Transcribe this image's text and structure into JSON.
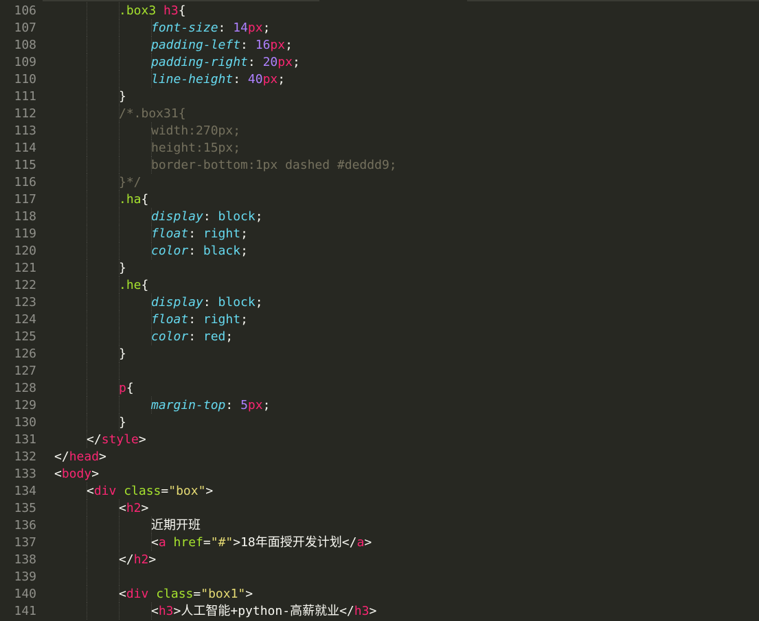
{
  "editor": {
    "theme": "monokai",
    "colors": {
      "background": "#272822",
      "line_number": "#90908a",
      "punctuation": "#f8f8f2",
      "selector": "#a6e22e",
      "tag": "#f92672",
      "property": "#66d9ef",
      "number": "#ae81ff",
      "unit": "#f92672",
      "value": "#66d9ef",
      "comment": "#75715e",
      "attribute": "#a6e22e",
      "string": "#e6db74",
      "text": "#f8f8f2"
    },
    "lines": [
      {
        "num": "106",
        "indent": 2,
        "tokens": [
          {
            "t": "sel",
            "v": ".box3 "
          },
          {
            "t": "tag",
            "v": "h3"
          },
          {
            "t": "punct",
            "v": "{"
          }
        ]
      },
      {
        "num": "107",
        "indent": 3,
        "tokens": [
          {
            "t": "prop",
            "v": "font-size"
          },
          {
            "t": "punct",
            "v": ": "
          },
          {
            "t": "num",
            "v": "14"
          },
          {
            "t": "unit",
            "v": "px"
          },
          {
            "t": "punct",
            "v": ";"
          }
        ]
      },
      {
        "num": "108",
        "indent": 3,
        "tokens": [
          {
            "t": "prop",
            "v": "padding-left"
          },
          {
            "t": "punct",
            "v": ": "
          },
          {
            "t": "num",
            "v": "16"
          },
          {
            "t": "unit",
            "v": "px"
          },
          {
            "t": "punct",
            "v": ";"
          }
        ]
      },
      {
        "num": "109",
        "indent": 3,
        "tokens": [
          {
            "t": "prop",
            "v": "padding-right"
          },
          {
            "t": "punct",
            "v": ": "
          },
          {
            "t": "num",
            "v": "20"
          },
          {
            "t": "unit",
            "v": "px"
          },
          {
            "t": "punct",
            "v": ";"
          }
        ]
      },
      {
        "num": "110",
        "indent": 3,
        "tokens": [
          {
            "t": "prop",
            "v": "line-height"
          },
          {
            "t": "punct",
            "v": ": "
          },
          {
            "t": "num",
            "v": "40"
          },
          {
            "t": "unit",
            "v": "px"
          },
          {
            "t": "punct",
            "v": ";"
          }
        ]
      },
      {
        "num": "111",
        "indent": 2,
        "tokens": [
          {
            "t": "punct",
            "v": "}"
          }
        ]
      },
      {
        "num": "112",
        "indent": 2,
        "tokens": [
          {
            "t": "comment",
            "v": "/*.box31{"
          }
        ]
      },
      {
        "num": "113",
        "indent": 3,
        "tokens": [
          {
            "t": "comment",
            "v": "width:270px;"
          }
        ]
      },
      {
        "num": "114",
        "indent": 3,
        "tokens": [
          {
            "t": "comment",
            "v": "height:15px;"
          }
        ]
      },
      {
        "num": "115",
        "indent": 3,
        "tokens": [
          {
            "t": "comment",
            "v": "border-bottom:1px dashed #deddd9;"
          }
        ]
      },
      {
        "num": "116",
        "indent": 2,
        "tokens": [
          {
            "t": "comment",
            "v": "}*/"
          }
        ]
      },
      {
        "num": "117",
        "indent": 2,
        "tokens": [
          {
            "t": "sel",
            "v": ".ha"
          },
          {
            "t": "punct",
            "v": "{"
          }
        ]
      },
      {
        "num": "118",
        "indent": 3,
        "tokens": [
          {
            "t": "prop",
            "v": "display"
          },
          {
            "t": "punct",
            "v": ": "
          },
          {
            "t": "val",
            "v": "block"
          },
          {
            "t": "punct",
            "v": ";"
          }
        ]
      },
      {
        "num": "119",
        "indent": 3,
        "tokens": [
          {
            "t": "prop",
            "v": "float"
          },
          {
            "t": "punct",
            "v": ": "
          },
          {
            "t": "val",
            "v": "right"
          },
          {
            "t": "punct",
            "v": ";"
          }
        ]
      },
      {
        "num": "120",
        "indent": 3,
        "tokens": [
          {
            "t": "prop",
            "v": "color"
          },
          {
            "t": "punct",
            "v": ": "
          },
          {
            "t": "val",
            "v": "black"
          },
          {
            "t": "punct",
            "v": ";"
          }
        ]
      },
      {
        "num": "121",
        "indent": 2,
        "tokens": [
          {
            "t": "punct",
            "v": "}"
          }
        ]
      },
      {
        "num": "122",
        "indent": 2,
        "tokens": [
          {
            "t": "sel",
            "v": ".he"
          },
          {
            "t": "punct",
            "v": "{"
          }
        ]
      },
      {
        "num": "123",
        "indent": 3,
        "tokens": [
          {
            "t": "prop",
            "v": "display"
          },
          {
            "t": "punct",
            "v": ": "
          },
          {
            "t": "val",
            "v": "block"
          },
          {
            "t": "punct",
            "v": ";"
          }
        ]
      },
      {
        "num": "124",
        "indent": 3,
        "tokens": [
          {
            "t": "prop",
            "v": "float"
          },
          {
            "t": "punct",
            "v": ": "
          },
          {
            "t": "val",
            "v": "right"
          },
          {
            "t": "punct",
            "v": ";"
          }
        ]
      },
      {
        "num": "125",
        "indent": 3,
        "tokens": [
          {
            "t": "prop",
            "v": "color"
          },
          {
            "t": "punct",
            "v": ": "
          },
          {
            "t": "val",
            "v": "red"
          },
          {
            "t": "punct",
            "v": ";"
          }
        ]
      },
      {
        "num": "126",
        "indent": 2,
        "tokens": [
          {
            "t": "punct",
            "v": "}"
          }
        ]
      },
      {
        "num": "127",
        "indent": 2,
        "tokens": []
      },
      {
        "num": "128",
        "indent": 2,
        "tokens": [
          {
            "t": "tag",
            "v": "p"
          },
          {
            "t": "punct",
            "v": "{"
          }
        ]
      },
      {
        "num": "129",
        "indent": 3,
        "tokens": [
          {
            "t": "prop",
            "v": "margin-top"
          },
          {
            "t": "punct",
            "v": ": "
          },
          {
            "t": "num",
            "v": "5"
          },
          {
            "t": "unit",
            "v": "px"
          },
          {
            "t": "punct",
            "v": ";"
          }
        ]
      },
      {
        "num": "130",
        "indent": 2,
        "tokens": [
          {
            "t": "punct",
            "v": "}"
          }
        ]
      },
      {
        "num": "131",
        "indent": 1,
        "tokens": [
          {
            "t": "punct",
            "v": "</"
          },
          {
            "t": "tag",
            "v": "style"
          },
          {
            "t": "punct",
            "v": ">"
          }
        ]
      },
      {
        "num": "132",
        "indent": 0,
        "tokens": [
          {
            "t": "punct",
            "v": "</"
          },
          {
            "t": "tag",
            "v": "head"
          },
          {
            "t": "punct",
            "v": ">"
          }
        ]
      },
      {
        "num": "133",
        "indent": 0,
        "tokens": [
          {
            "t": "punct",
            "v": "<"
          },
          {
            "t": "tag",
            "v": "body"
          },
          {
            "t": "punct",
            "v": ">"
          }
        ]
      },
      {
        "num": "134",
        "indent": 1,
        "tokens": [
          {
            "t": "punct",
            "v": "<"
          },
          {
            "t": "tag",
            "v": "div"
          },
          {
            "t": "text",
            "v": " "
          },
          {
            "t": "attr",
            "v": "class"
          },
          {
            "t": "punct",
            "v": "="
          },
          {
            "t": "str",
            "v": "\"box\""
          },
          {
            "t": "punct",
            "v": ">"
          }
        ]
      },
      {
        "num": "135",
        "indent": 2,
        "tokens": [
          {
            "t": "punct",
            "v": "<"
          },
          {
            "t": "tag",
            "v": "h2"
          },
          {
            "t": "punct",
            "v": ">"
          }
        ]
      },
      {
        "num": "136",
        "indent": 3,
        "tokens": [
          {
            "t": "text",
            "v": "近期开班"
          }
        ]
      },
      {
        "num": "137",
        "indent": 3,
        "tokens": [
          {
            "t": "punct",
            "v": "<"
          },
          {
            "t": "tag",
            "v": "a"
          },
          {
            "t": "text",
            "v": " "
          },
          {
            "t": "attr",
            "v": "href"
          },
          {
            "t": "punct",
            "v": "="
          },
          {
            "t": "str",
            "v": "\"#\""
          },
          {
            "t": "punct",
            "v": ">"
          },
          {
            "t": "text",
            "v": "18年面授开发计划"
          },
          {
            "t": "punct",
            "v": "</"
          },
          {
            "t": "tag",
            "v": "a"
          },
          {
            "t": "punct",
            "v": ">"
          }
        ]
      },
      {
        "num": "138",
        "indent": 2,
        "tokens": [
          {
            "t": "punct",
            "v": "</"
          },
          {
            "t": "tag",
            "v": "h2"
          },
          {
            "t": "punct",
            "v": ">"
          }
        ]
      },
      {
        "num": "139",
        "indent": 2,
        "tokens": []
      },
      {
        "num": "140",
        "indent": 2,
        "tokens": [
          {
            "t": "punct",
            "v": "<"
          },
          {
            "t": "tag",
            "v": "div"
          },
          {
            "t": "text",
            "v": " "
          },
          {
            "t": "attr",
            "v": "class"
          },
          {
            "t": "punct",
            "v": "="
          },
          {
            "t": "str",
            "v": "\"box1\""
          },
          {
            "t": "punct",
            "v": ">"
          }
        ]
      },
      {
        "num": "141",
        "indent": 3,
        "tokens": [
          {
            "t": "punct",
            "v": "<"
          },
          {
            "t": "tag",
            "v": "h3"
          },
          {
            "t": "punct",
            "v": ">"
          },
          {
            "t": "text",
            "v": "人工智能+python-高薪就业"
          },
          {
            "t": "punct",
            "v": "</"
          },
          {
            "t": "tag",
            "v": "h3"
          },
          {
            "t": "punct",
            "v": ">"
          }
        ]
      }
    ]
  }
}
